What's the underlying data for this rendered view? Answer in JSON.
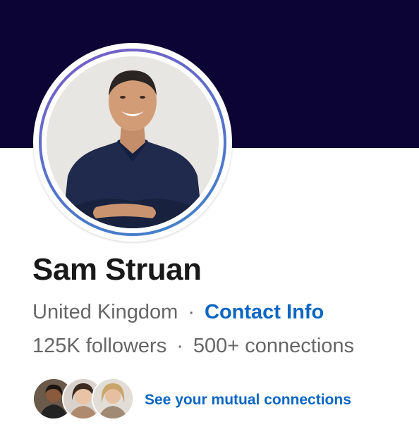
{
  "profile": {
    "name": "Sam Struan",
    "location": "United Kingdom",
    "separator": "·",
    "contact_info_label": "Contact Info",
    "followers": "125K followers",
    "connections": "500+ connections"
  },
  "mutual": {
    "link_label": "See your mutual connections",
    "avatars": [
      "mutual-avatar-1",
      "mutual-avatar-2",
      "mutual-avatar-3"
    ]
  },
  "colors": {
    "banner": "#0c0434",
    "link": "#0a66c2",
    "name": "#191919",
    "meta": "#666666",
    "ring_start": "#7b5cc7",
    "ring_end": "#3f83c9"
  }
}
